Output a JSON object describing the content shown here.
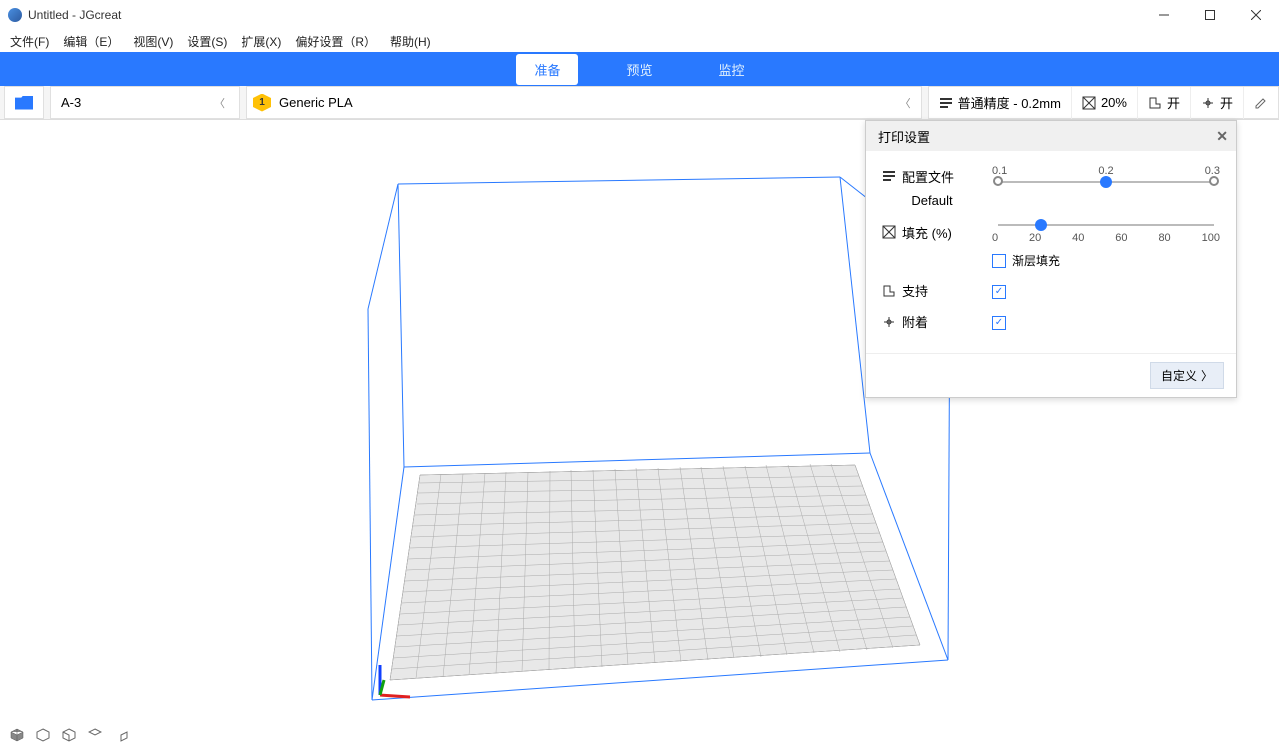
{
  "title": "Untitled - JGcreat",
  "menu": {
    "file": "文件(F)",
    "edit": "编辑（E）",
    "view": "视图(V)",
    "settings": "设置(S)",
    "extensions": "扩展(X)",
    "prefs": "偏好设置（R）",
    "help": "帮助(H)"
  },
  "tabs": {
    "prepare": "准备",
    "preview": "预览",
    "monitor": "监控"
  },
  "toolbar": {
    "printer": "A-3",
    "material_badge": "1",
    "material": "Generic PLA",
    "profile_label": "普通精度 - 0.2mm",
    "infill": "20%",
    "support": "开",
    "adhesion": "开"
  },
  "panel": {
    "title": "打印设置",
    "profile_label": "配置文件",
    "profile_value": "Default",
    "ticks": [
      "0.1",
      "0.2",
      "0.3"
    ],
    "infill_label": "填充 (%)",
    "infill_ticks": [
      "0",
      "20",
      "40",
      "60",
      "80",
      "100"
    ],
    "gradual_label": "渐层填充",
    "support_label": "支持",
    "adhesion_label": "附着",
    "custom_btn": "自定义"
  }
}
